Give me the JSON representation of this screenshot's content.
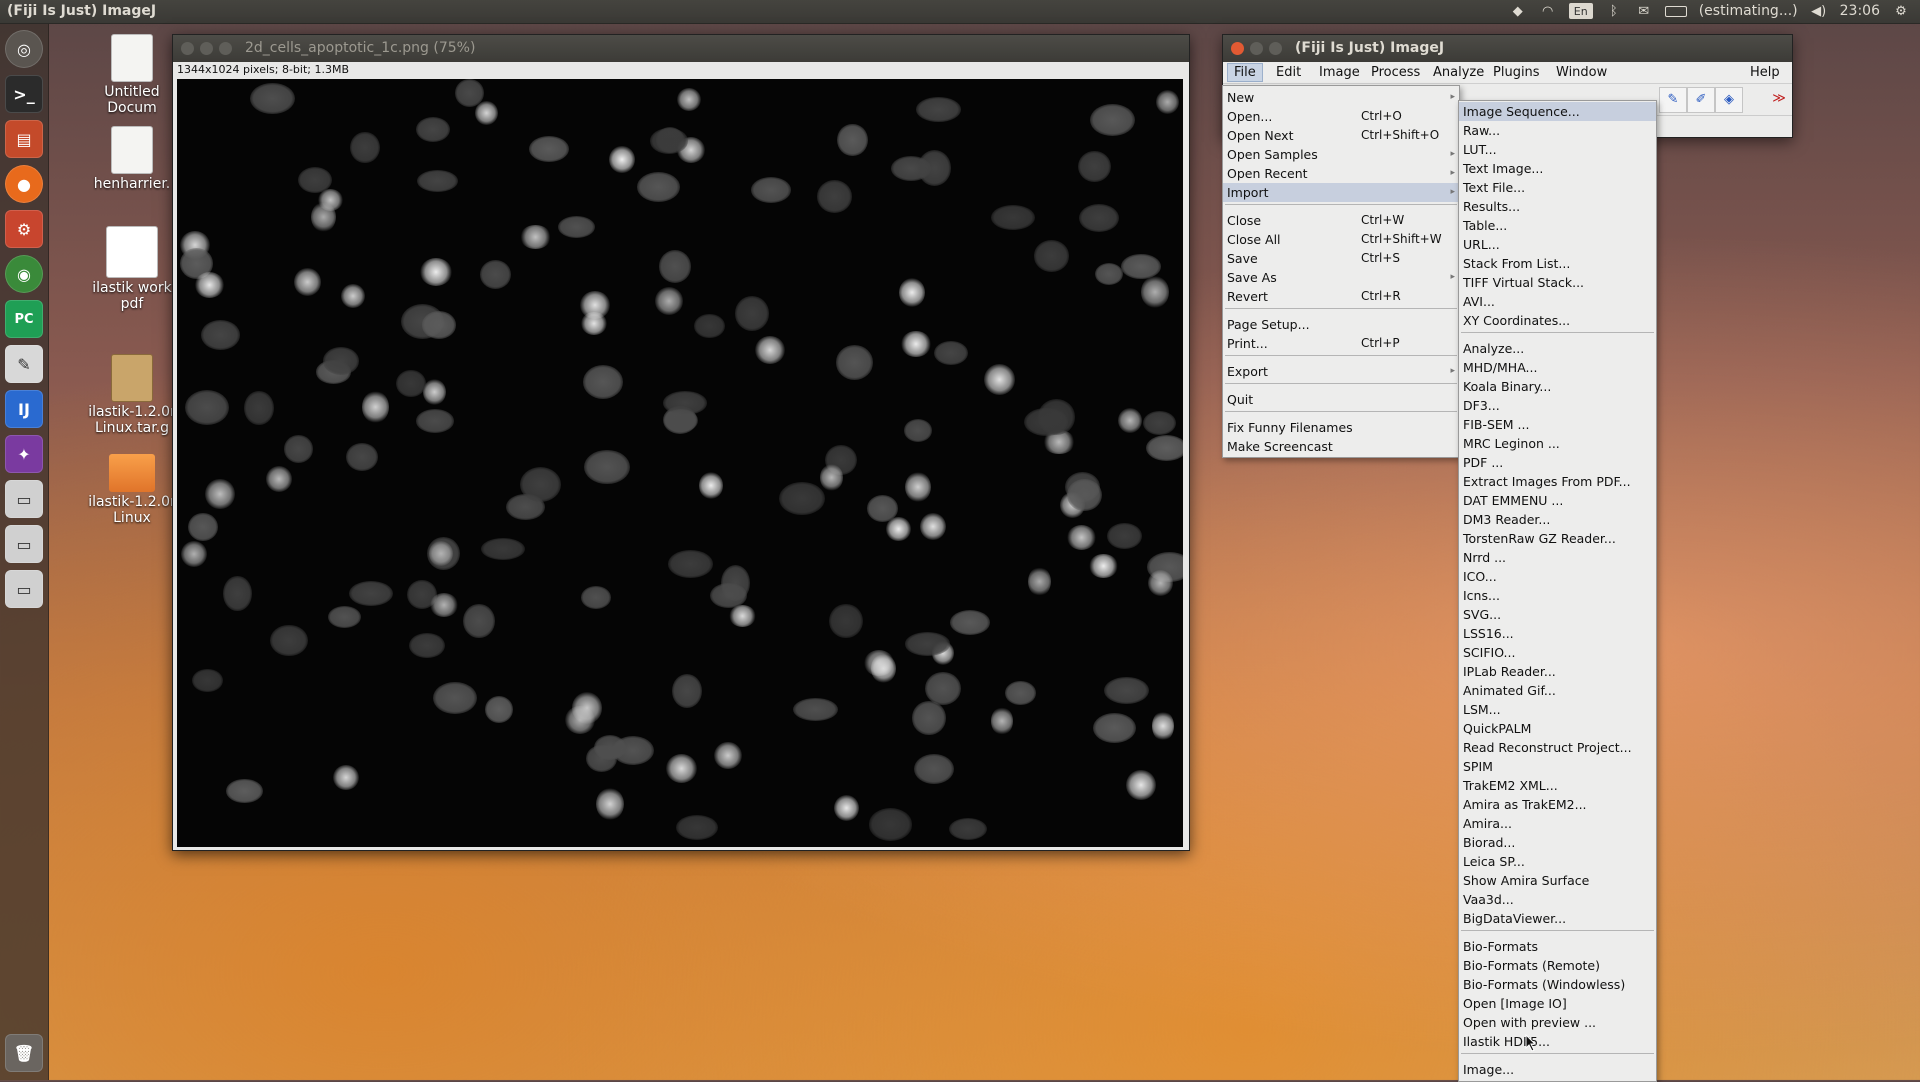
{
  "top_panel": {
    "title": "(Fiji Is Just) ImageJ",
    "lang": "En",
    "battery_text": "(estimating...)",
    "clock": "23:06"
  },
  "desktop_icons": [
    {
      "label": "Untitled Docum",
      "icon": "document-icon"
    },
    {
      "label": "henharrier.",
      "icon": "document-icon"
    },
    {
      "label": "ilastik work pdf",
      "icon": "pdf-icon"
    },
    {
      "label": "ilastik-1.2.0r Linux.tar.g",
      "icon": "archive-icon"
    },
    {
      "label": "ilastik-1.2.0r Linux",
      "icon": "folder-icon"
    }
  ],
  "image_window": {
    "title": "2d_cells_apoptotic_1c.png (75%)",
    "info": "1344x1024 pixels; 8-bit; 1.3MB"
  },
  "fiji_window": {
    "title": "(Fiji Is Just) ImageJ",
    "menus": [
      "File",
      "Edit",
      "Image",
      "Process",
      "Analyze",
      "Plugins",
      "Window",
      "Help"
    ]
  },
  "file_menu": {
    "items": [
      {
        "label": "New",
        "shortcut": ""
      },
      {
        "label": "Open...",
        "shortcut": "Ctrl+O"
      },
      {
        "label": "Open Next",
        "shortcut": "Ctrl+Shift+O"
      },
      {
        "label": "Open Samples",
        "shortcut": ""
      },
      {
        "label": "Open Recent",
        "shortcut": ""
      },
      {
        "label": "Import",
        "shortcut": ""
      },
      {
        "label": "Close",
        "shortcut": "Ctrl+W"
      },
      {
        "label": "Close All",
        "shortcut": "Ctrl+Shift+W"
      },
      {
        "label": "Save",
        "shortcut": "Ctrl+S"
      },
      {
        "label": "Save As",
        "shortcut": ""
      },
      {
        "label": "Revert",
        "shortcut": "Ctrl+R"
      },
      {
        "label": "Page Setup...",
        "shortcut": ""
      },
      {
        "label": "Print...",
        "shortcut": "Ctrl+P"
      },
      {
        "label": "Export",
        "shortcut": ""
      },
      {
        "label": "Quit",
        "shortcut": ""
      },
      {
        "label": "Fix Funny Filenames",
        "shortcut": ""
      },
      {
        "label": "Make Screencast",
        "shortcut": ""
      }
    ]
  },
  "import_menu": {
    "items": [
      "Image Sequence...",
      "Raw...",
      "LUT...",
      "Text Image...",
      "Text File...",
      "Results...",
      "Table...",
      "URL...",
      "Stack From List...",
      "TIFF Virtual Stack...",
      "AVI...",
      "XY Coordinates...",
      "Analyze...",
      "MHD/MHA...",
      "Koala Binary...",
      "DF3...",
      "FIB-SEM ...",
      "MRC Leginon ...",
      "PDF ...",
      "Extract Images From PDF...",
      "DAT EMMENU ...",
      "DM3 Reader...",
      "TorstenRaw GZ Reader...",
      "Nrrd ...",
      "ICO...",
      "Icns...",
      "SVG...",
      "LSS16...",
      "SCIFIO...",
      "IPLab Reader...",
      "Animated Gif...",
      "LSM...",
      "QuickPALM",
      "Read Reconstruct Project...",
      "SPIM",
      "TrakEM2 XML...",
      "Amira as TrakEM2...",
      "Amira...",
      "Biorad...",
      "Leica SP...",
      "Show Amira Surface",
      "Vaa3d...",
      "BigDataViewer...",
      "Bio-Formats",
      "Bio-Formats (Remote)",
      "Bio-Formats (Windowless)",
      "Open [Image IO]",
      "Open with preview ...",
      "Ilastik HDF5...",
      "Image..."
    ]
  }
}
